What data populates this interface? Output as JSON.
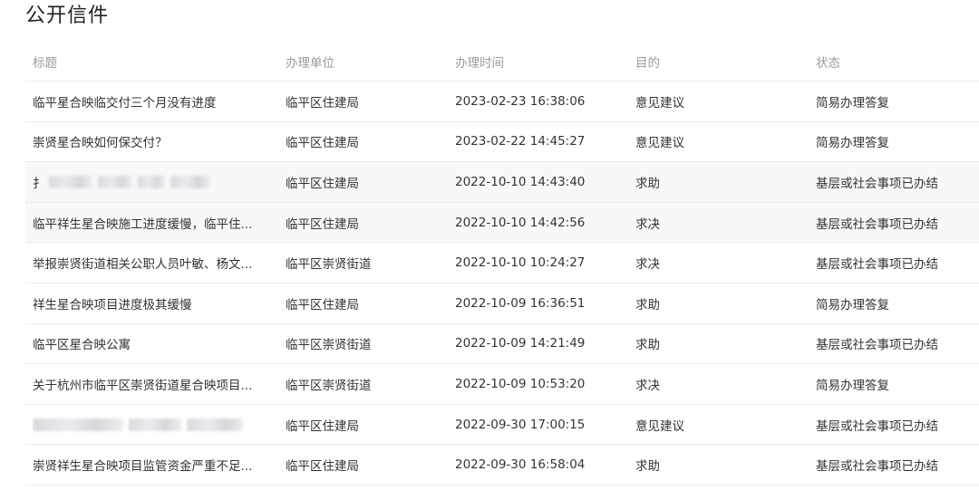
{
  "page": {
    "title": "公开信件"
  },
  "table": {
    "headers": {
      "title": "标题",
      "unit": "办理单位",
      "time": "办理时间",
      "purpose": "目的",
      "status": "状态"
    },
    "rows": [
      {
        "title": "临平星合映临交付三个月没有进度",
        "unit": "临平区住建局",
        "time": "2023-02-23 16:38:06",
        "purpose": "意见建议",
        "status": "简易办理答复"
      },
      {
        "title": "崇贤星合映如何保交付？",
        "unit": "临平区住建局",
        "time": "2023-02-22 14:45:27",
        "purpose": "意见建议",
        "status": "简易办理答复"
      },
      {
        "title": "扌",
        "unit": "临平区住建局",
        "time": "2022-10-10 14:43:40",
        "purpose": "求助",
        "status": "基层或社会事项已办结"
      },
      {
        "title": "临平祥生星合映施工进度缓慢，临平住...",
        "unit": "临平区住建局",
        "time": "2022-10-10 14:42:56",
        "purpose": "求决",
        "status": "基层或社会事项已办结"
      },
      {
        "title": "举报崇贤街道相关公职人员叶敏、杨文...",
        "unit": "临平区崇贤街道",
        "time": "2022-10-10 10:24:27",
        "purpose": "求决",
        "status": "基层或社会事项已办结"
      },
      {
        "title": "祥生星合映项目进度极其缓慢",
        "unit": "临平区住建局",
        "time": "2022-10-09 16:36:51",
        "purpose": "求助",
        "status": "简易办理答复"
      },
      {
        "title": "临平区星合映公寓",
        "unit": "临平区崇贤街道",
        "time": "2022-10-09 14:21:49",
        "purpose": "求助",
        "status": "基层或社会事项已办结"
      },
      {
        "title": "关于杭州市临平区崇贤街道星合映项目...",
        "unit": "临平区崇贤街道",
        "time": "2022-10-09 10:53:20",
        "purpose": "求决",
        "status": "简易办理答复"
      },
      {
        "title": "",
        "unit": "临平区住建局",
        "time": "2022-09-30 17:00:15",
        "purpose": "意见建议",
        "status": "基层或社会事项已办结"
      },
      {
        "title": "崇贤祥生星合映项目监管资金严重不足...",
        "unit": "临平区住建局",
        "time": "2022-09-30 16:58:04",
        "purpose": "求助",
        "status": "基层或社会事项已办结"
      }
    ]
  }
}
